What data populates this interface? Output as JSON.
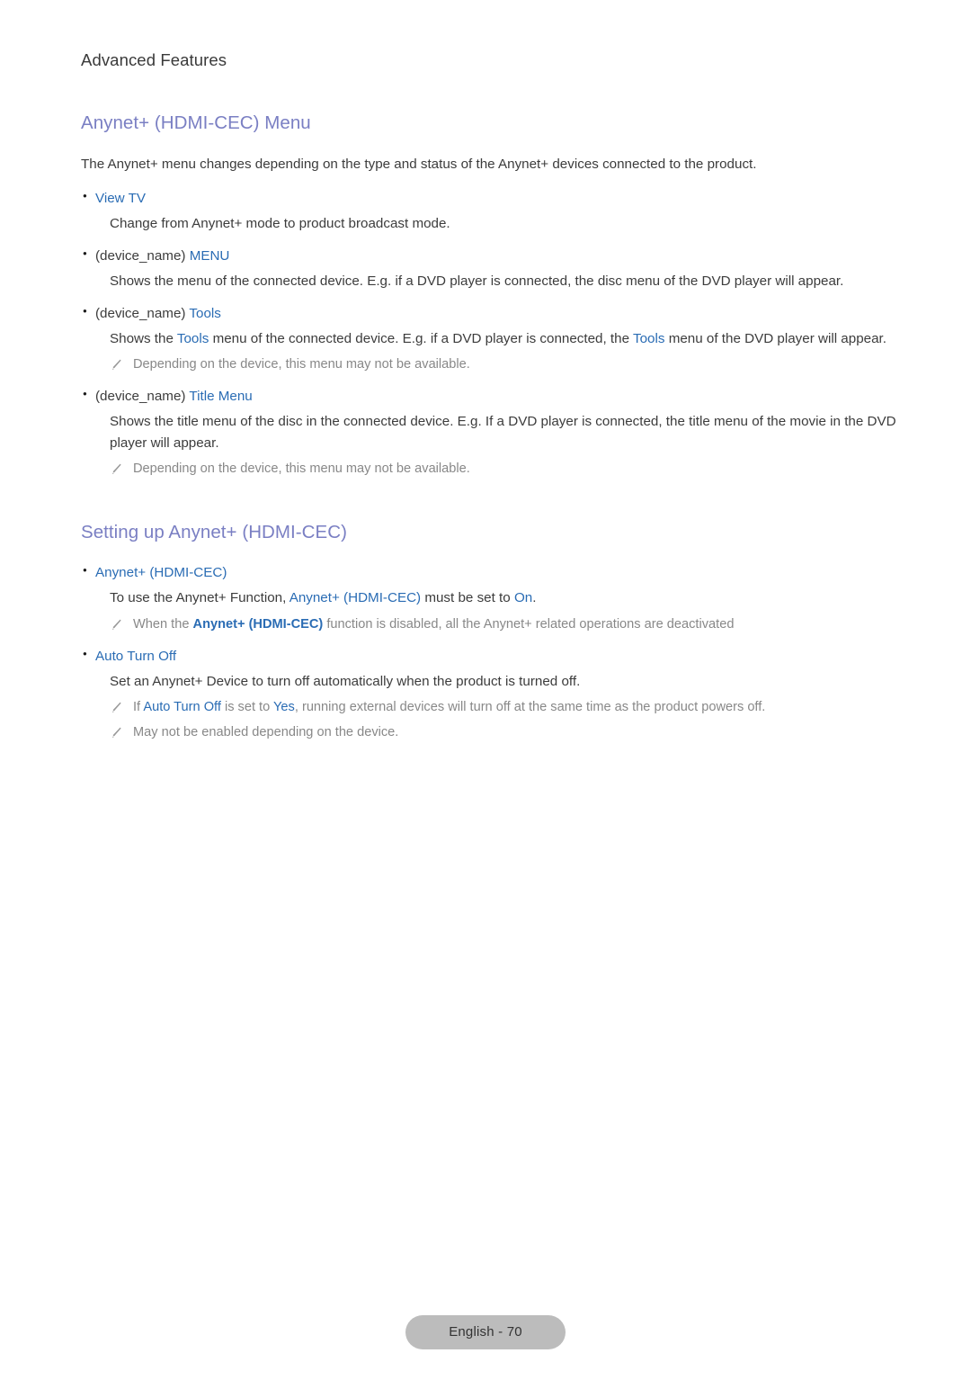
{
  "page": {
    "running_head": "Advanced Features",
    "footer_label": "English - 70"
  },
  "colors": {
    "heading_purple": "#7a7fc3",
    "link_blue": "#2a6cb4",
    "body_text": "#3c3c3c",
    "note_text": "#888888",
    "footer_pill_bg": "#bcbcbc",
    "page_bg": "#ffffff"
  },
  "sections": [
    {
      "heading": "Anynet+ (HDMI-CEC) Menu",
      "intro": "The Anynet+ menu changes depending on the type and status of the Anynet+ devices connected to the product.",
      "items": [
        {
          "label_plain": "",
          "label_link": "View TV",
          "description": "Change from Anynet+ mode to product broadcast mode.",
          "notes": []
        },
        {
          "label_plain": "(device_name) ",
          "label_link": "MENU",
          "description_part1": "Shows the menu of the connected device. E.g. if a DVD player is connected, the disc menu of the DVD player will appear.",
          "notes": []
        },
        {
          "label_plain": "(device_name) ",
          "label_link": "Tools",
          "desc_a": "Shows the ",
          "desc_link1": "Tools",
          "desc_b": " menu of the connected device. E.g. if a DVD player is connected, the ",
          "desc_link2": "Tools",
          "desc_c": " menu of the DVD player will appear.",
          "notes": [
            {
              "text": "Depending on the device, this menu may not be available."
            }
          ]
        },
        {
          "label_plain": "(device_name) ",
          "label_link": "Title Menu",
          "description": "Shows the title menu of the disc in the connected device. E.g. If a DVD player is connected, the title menu of the movie in the DVD player will appear.",
          "notes": [
            {
              "text": "Depending on the device, this menu may not be available."
            }
          ]
        }
      ]
    },
    {
      "heading": "Setting up Anynet+ (HDMI-CEC)",
      "items": [
        {
          "label_plain": "",
          "label_link": "Anynet+ (HDMI-CEC)",
          "desc_a": "To use the Anynet+ Function, ",
          "desc_link1": "Anynet+ (HDMI-CEC)",
          "desc_b": " must be set to ",
          "desc_link2": "On",
          "desc_c": ".",
          "notes": [
            {
              "a": "When the ",
              "link_bold": "Anynet+ (HDMI-CEC)",
              "b": " function is disabled, all the Anynet+ related operations are deactivated"
            }
          ]
        },
        {
          "label_plain": "",
          "label_link": "Auto Turn Off",
          "description": "Set an Anynet+ Device to turn off automatically when the product is turned off.",
          "notes": [
            {
              "a": "If ",
              "link1": "Auto Turn Off",
              "b": " is set to ",
              "link2": "Yes",
              "c": ", running external devices will turn off at the same time as the product powers off."
            },
            {
              "text": "May not be enabled depending on the device."
            }
          ]
        }
      ]
    }
  ]
}
